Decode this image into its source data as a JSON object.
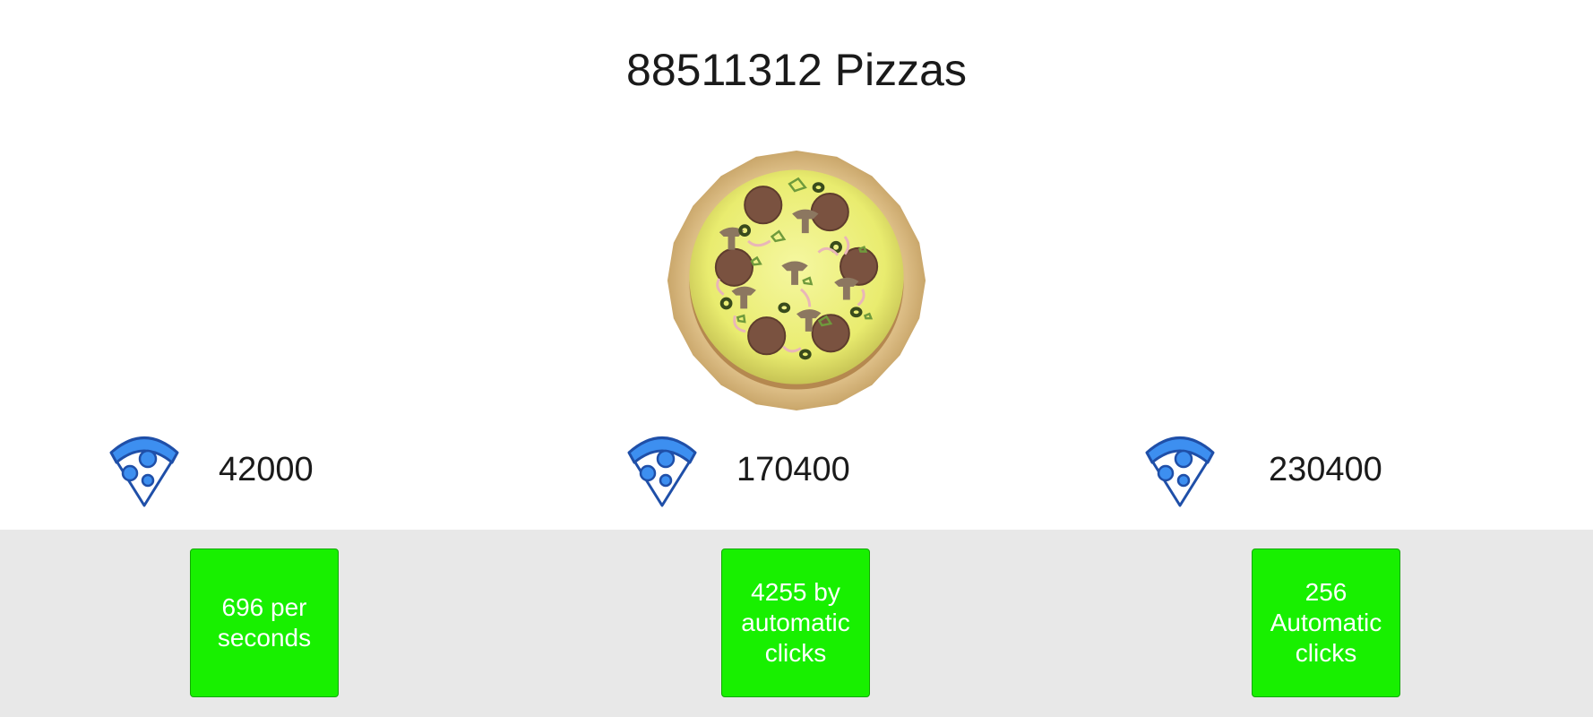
{
  "header": {
    "pizza_count": "88511312 Pizzas"
  },
  "pizza": {
    "icon": "pizza-icon"
  },
  "upgrades": [
    {
      "icon": "pizza-slice-icon",
      "cost": "42000",
      "button_label": "696 per seconds"
    },
    {
      "icon": "pizza-slice-icon",
      "cost": "170400",
      "button_label": "4255 by automatic clicks"
    },
    {
      "icon": "pizza-slice-icon",
      "cost": "230400",
      "button_label": "256 Automatic clicks"
    }
  ],
  "colors": {
    "button_bg": "#18f000",
    "panel_bg": "#e8e8e8",
    "icon_blue": "#3d8ff0",
    "crust": "#d9b97f",
    "cheese": "#eef07a"
  }
}
